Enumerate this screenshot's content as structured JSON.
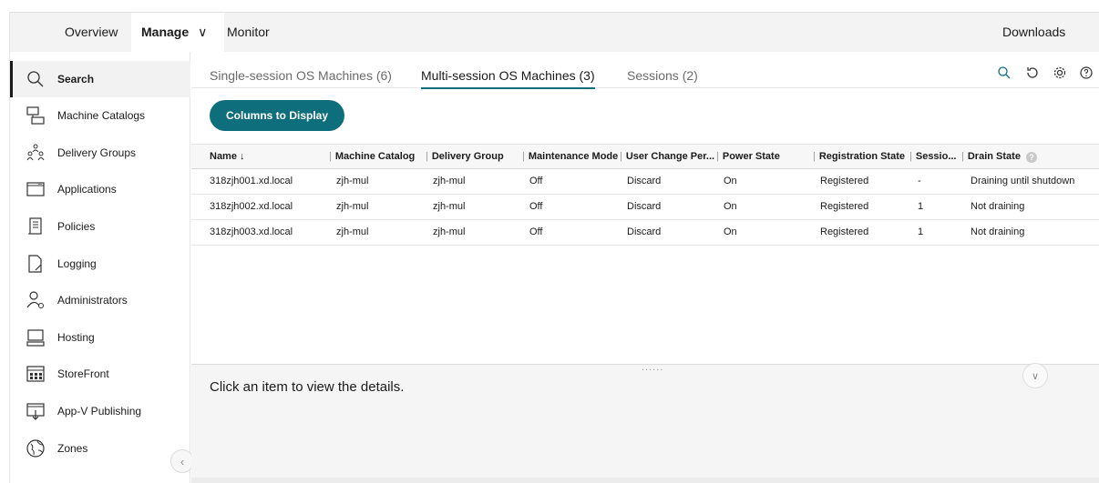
{
  "topnav": {
    "overview": "Overview",
    "manage": "Manage",
    "manage_chevron": "∨",
    "monitor": "Monitor",
    "downloads": "Downloads"
  },
  "sidebar": {
    "items": [
      {
        "label": "Search",
        "icon": "search-icon"
      },
      {
        "label": "Machine Catalogs",
        "icon": "machine-catalogs-icon"
      },
      {
        "label": "Delivery Groups",
        "icon": "delivery-groups-icon"
      },
      {
        "label": "Applications",
        "icon": "applications-icon"
      },
      {
        "label": "Policies",
        "icon": "policies-icon"
      },
      {
        "label": "Logging",
        "icon": "logging-icon"
      },
      {
        "label": "Administrators",
        "icon": "administrators-icon"
      },
      {
        "label": "Hosting",
        "icon": "hosting-icon"
      },
      {
        "label": "StoreFront",
        "icon": "storefront-icon"
      },
      {
        "label": "App-V Publishing",
        "icon": "appv-publishing-icon"
      },
      {
        "label": "Zones",
        "icon": "zones-icon"
      }
    ],
    "collapse_glyph": "‹"
  },
  "tabs": [
    {
      "label": "Single-session OS Machines (6)"
    },
    {
      "label": "Multi-session OS Machines (3)",
      "active": true
    },
    {
      "label": "Sessions (2)"
    }
  ],
  "toolbar": {
    "columns_button": "Columns to Display"
  },
  "table": {
    "headers": [
      "Name ↓",
      "Machine Catalog",
      "Delivery Group",
      "Maintenance Mode",
      "User Change Per...",
      "Power State",
      "Registration State",
      "Sessio...",
      "Drain State"
    ],
    "rows": [
      [
        "318zjh001.xd.local",
        "zjh-mul",
        "zjh-mul",
        "Off",
        "Discard",
        "On",
        "Registered",
        "-",
        "Draining until shutdown"
      ],
      [
        "318zjh002.xd.local",
        "zjh-mul",
        "zjh-mul",
        "Off",
        "Discard",
        "On",
        "Registered",
        "1",
        "Not draining"
      ],
      [
        "318zjh003.xd.local",
        "zjh-mul",
        "zjh-mul",
        "Off",
        "Discard",
        "On",
        "Registered",
        "1",
        "Not draining"
      ]
    ],
    "drain_help": "?"
  },
  "details": {
    "message": "Click an item to view the details.",
    "grip": "......",
    "expand_glyph": "∨"
  },
  "colors": {
    "accent": "#0e6e7c",
    "topbar_bg": "#f3f3f3",
    "details_bg": "#f5f5f5"
  }
}
